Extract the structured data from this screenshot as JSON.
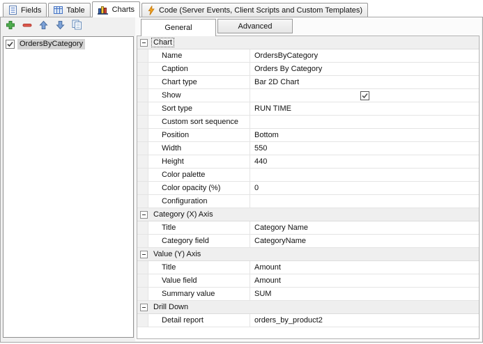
{
  "main_tabs": [
    {
      "label": "Fields",
      "icon": "form-icon"
    },
    {
      "label": "Table",
      "icon": "table-icon"
    },
    {
      "label": "Charts",
      "icon": "bar-chart-icon",
      "active": true
    },
    {
      "label": "Code (Server Events, Client Scripts and Custom Templates)",
      "icon": "lightning-icon"
    }
  ],
  "toolbar": {
    "buttons": [
      {
        "name": "add",
        "icon": "plus-icon"
      },
      {
        "name": "remove",
        "icon": "minus-icon"
      },
      {
        "name": "move-up",
        "icon": "arrow-up-icon"
      },
      {
        "name": "move-down",
        "icon": "arrow-down-icon"
      },
      {
        "name": "copy",
        "icon": "copy-icon"
      }
    ]
  },
  "chart_list": {
    "items": [
      {
        "label": "OrdersByCategory",
        "checked": true,
        "selected": true
      }
    ]
  },
  "detail_tabs": [
    {
      "label": "General",
      "active": true
    },
    {
      "label": "Advanced"
    }
  ],
  "property_grid": {
    "sections": [
      {
        "title": "Chart",
        "focused": true,
        "rows": [
          {
            "name": "Name",
            "value": "OrdersByCategory"
          },
          {
            "name": "Caption",
            "value": "Orders By Category"
          },
          {
            "name": "Chart type",
            "value": "Bar 2D Chart"
          },
          {
            "name": "Show",
            "type": "checkbox",
            "checked": true
          },
          {
            "name": "Sort type",
            "value": "RUN TIME"
          },
          {
            "name": "Custom sort sequence",
            "value": ""
          },
          {
            "name": "Position",
            "value": "Bottom"
          },
          {
            "name": "Width",
            "value": "550"
          },
          {
            "name": "Height",
            "value": "440"
          },
          {
            "name": "Color palette",
            "value": ""
          },
          {
            "name": "Color opacity (%)",
            "value": "0"
          },
          {
            "name": "Configuration",
            "value": ""
          }
        ]
      },
      {
        "title": "Category (X) Axis",
        "rows": [
          {
            "name": "Title",
            "value": "Category Name"
          },
          {
            "name": "Category field",
            "value": "CategoryName"
          }
        ]
      },
      {
        "title": "Value (Y) Axis",
        "rows": [
          {
            "name": "Title",
            "value": "Amount"
          },
          {
            "name": "Value field",
            "value": "Amount"
          },
          {
            "name": "Summary value",
            "value": "SUM"
          }
        ]
      },
      {
        "title": "Drill Down",
        "rows": [
          {
            "name": "Detail report",
            "value": "orders_by_product2"
          }
        ]
      }
    ]
  },
  "colors": {
    "page_background": "#f0f0f0",
    "selection_gray": "#d4d4d4",
    "section_header_bg": "#efefef",
    "grid_line": "#e4e4e4",
    "accent_blue": "#4472c4",
    "add_green": "#4fae4f",
    "remove_red": "#e05a4e",
    "lightning_orange": "#f6a821"
  }
}
